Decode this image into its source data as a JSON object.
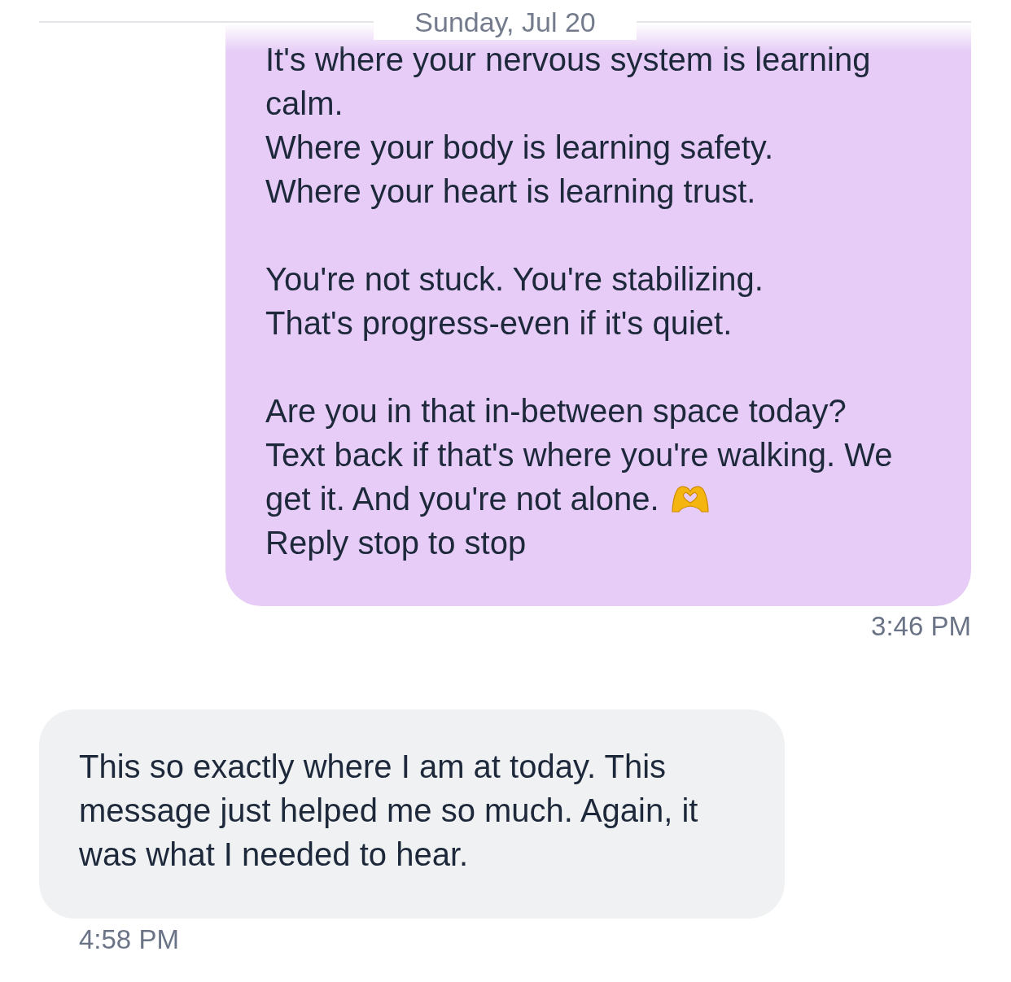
{
  "date_separator": {
    "label": "Sunday, Jul 20"
  },
  "messages": [
    {
      "kind": "sent",
      "paragraphs": [
        {
          "lines": [
            {
              "text": "It's where your nervous system is learning calm.",
              "emoji": false
            },
            {
              "text": "Where your body is learning safety.",
              "emoji": false
            },
            {
              "text": "Where your heart is learning trust.",
              "emoji": false
            }
          ]
        },
        {
          "lines": [
            {
              "text": "You're not stuck. You're stabilizing.",
              "emoji": false
            },
            {
              "text": "That's progress-even if it's quiet.",
              "emoji": false
            }
          ]
        },
        {
          "lines": [
            {
              "text": "Are you in that in-between space today?",
              "emoji": false
            },
            {
              "text": "Text back if that's where you're walking. We",
              "emoji": false
            },
            {
              "text": "get it. And you're not alone.",
              "emoji": true
            },
            {
              "text": "Reply stop to stop",
              "emoji": false
            }
          ]
        }
      ],
      "time": "3:46 PM"
    },
    {
      "kind": "received",
      "paragraphs": [
        {
          "lines": [
            {
              "text": "This so exactly where I am at today. This message just helped me so much. Again, it was what I needed to hear.",
              "emoji": false
            }
          ]
        }
      ],
      "time": "4:58 PM"
    }
  ]
}
